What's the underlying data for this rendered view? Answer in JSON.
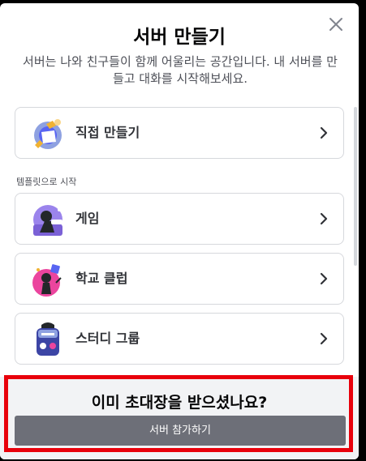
{
  "modal": {
    "title": "서버 만들기",
    "subtitle": "서버는 나와 친구들이 함께 어울리는 공간입니다. 내 서버를 만들고 대화를 시작해보세요."
  },
  "options": {
    "create_own": {
      "label": "직접 만들기",
      "icon": "create-own-art"
    },
    "section_label": "템플릿으로 시작",
    "templates": [
      {
        "label": "게임",
        "icon": "gaming-art"
      },
      {
        "label": "학교 클럽",
        "icon": "school-club-art"
      },
      {
        "label": "스터디 그룹",
        "icon": "study-group-art"
      }
    ]
  },
  "footer": {
    "title": "이미 초대장을 받으셨나요?",
    "join_label": "서버 참가하기"
  },
  "colors": {
    "highlight": "#e8000b",
    "join_button": "#6d6f78",
    "footer_bg": "#f2f3f5"
  }
}
